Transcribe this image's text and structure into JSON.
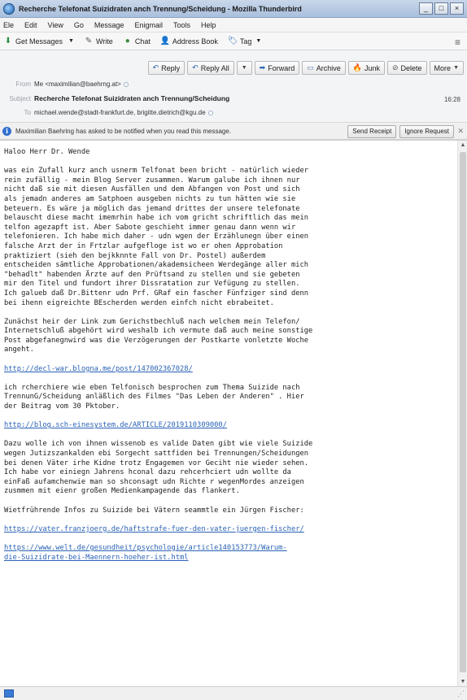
{
  "window": {
    "title": "Recherche Telefonat Suizidraten anch Trennung/Scheidung - Mozilla Thunderbird",
    "controls": [
      "_",
      "□",
      "×"
    ]
  },
  "menu": [
    "Ele",
    "Edit",
    "View",
    "Go",
    "Message",
    "Enigmail",
    "Tools",
    "Help"
  ],
  "toolbar": {
    "get_messages": "Get Messages",
    "write": "Write",
    "chat": "Chat",
    "address_book": "Address Book",
    "tag": "Tag"
  },
  "actions": {
    "reply": "Reply",
    "reply_all": "Reply All",
    "forward": "Forward",
    "archive": "Archive",
    "junk": "Junk",
    "delete": "Delete",
    "more": "More"
  },
  "header": {
    "from_label": "From",
    "from_value": "Me <maximilian@baehrng.at>",
    "subject_label": "Subject",
    "subject_value": "Recherche Telefonat Suizidraten anch Trennung/Scheidung",
    "to_label": "To",
    "to_value": "michael.wende@stadt-frankfurt.de, brigitte.dietrich@kgu.de",
    "time": "16:28"
  },
  "notify": {
    "text": "Maximilian Baehring has asked to be notified when you read this message.",
    "send_receipt": "Send Receipt",
    "ignore_request": "Ignore Request"
  },
  "body": {
    "greeting": "Haloo Herr Dr. Wende",
    "para1": "was ein Zufall kurz anch usnerm Telfonat been bricht - natürlich wieder\nrein zufällig - mein Blog Server zusammen. Warum galube ich ihnen nur\nnicht daß sie mit diesen Ausfällen und dem Abfangen von Post und sich\nals jemadn anderes am Satphoen ausgeben nichts zu tun hätten wie sie\nbeteuern. Es wäre ja möglich das jemand drittes der unsere telefonate\nbelauscht diese macht imemrhin habe ich vom gricht schriftlich das mein\ntelfon agezapft ist. Aber Sabote geschieht immer genau dann wenn wir\ntelefonieren. Ich habe mich daher - udn wgen der Erzählunegn über einen\nfalsche Arzt der in Frtzlar aufgefloge ist wo er ohen Approbation\npraktiziert (sieh den bejkknnte Fall von Dr. Postel) außerdem\nentscheiden sämtliche Approbationen/akademsicheen Werdegänge aller mich\n\"behadlt\" habenden Ärzte auf den Prüftsand zu stellen und sie gebeten\nmir den Titel und fundort ihrer Dissratation zur Vefügung zu stellen.\nIch galueb daß Dr.Bittenr udn Prf. GRaf ein fascher Fünfziger sind denn\nbei ihenn eigreichte BEscherden werden einfch nicht ebrabeitet.",
    "para2": "Zunächst heir der Link zum Gerichstbechluß nach welchem mein Telefon/\nInternetschluß abgehört wird weshalb ich vermute daß auch meine sonstige\nPost abgefanegnwird was die Verzögerungen der Postkarte vonletzte Woche\nangeht.",
    "link1": "http://decl-war.blogna.me/post/147002367028/",
    "para3": "ich rcherchiere wie eben Telfonisch besprochen zum Thema Suizide nach\nTrennunG/Scheidung anläßlich des Filmes \"Das Leben der Anderen\" . Hier\nder Beitrag vom 30 Pktober.",
    "link2": "http://blog.sch-einesystem.de/ARTICLE/2019110309000/",
    "para4": "Dazu wolle ich von ihnen wissenob es valide Daten gibt wie viele Suizide\nwegen Jutizszankalden ebi Sorgecht sattfiden bei Trennungen/Scheidungen\nbei denen Väter irhe Kidne trotz Engagemen vor Geciht nie wieder sehen.\nIch habe vor einiegn Jahrens hconal dazu rehcerhciert udn wollte da\neinFaß aufamchenwie man so shconsagt udn Richte r wegenMordes anzeigen\nzusmmen mit eienr großen Medienkampagende das flankert.",
    "para5": "Wietfrührende Infos zu Suizide bei Vätern seammtle ein Jürgen Fischer:",
    "link3": "https://vater.franzjoerg.de/haftstrafe-fuer-den-vater-juergen-fischer/",
    "link4": "https://www.welt.de/gesundheit/psychologie/article140153773/Warum-\ndie-Suizidrate-bei-Maennern-hoeher-ist.html"
  }
}
